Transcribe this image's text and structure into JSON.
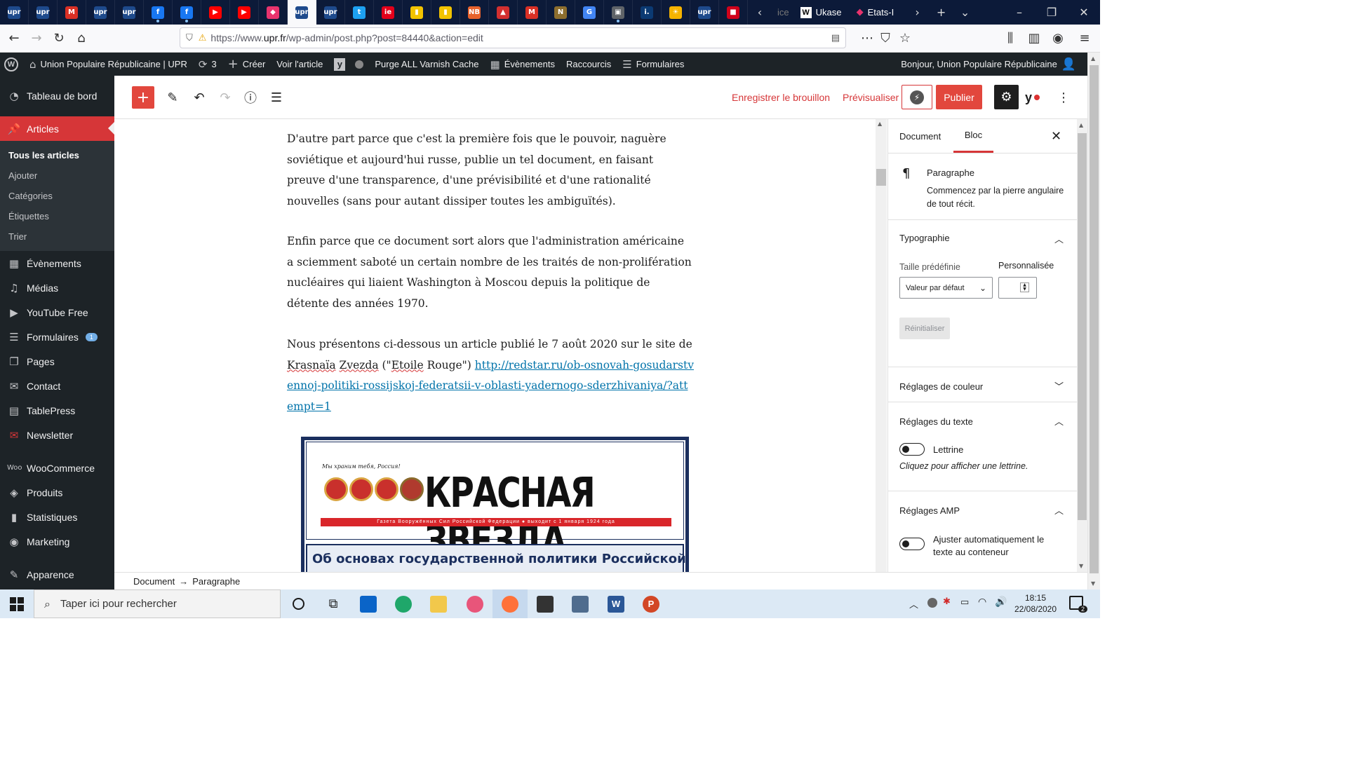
{
  "browser": {
    "tabs_favicons": [
      {
        "name": "upr-tab",
        "label": "upr",
        "color": "#1e4a8c"
      },
      {
        "name": "upr-tab",
        "label": "upr",
        "color": "#1e4a8c"
      },
      {
        "name": "gmail-tab",
        "label": "M",
        "color": "#d93025"
      },
      {
        "name": "upr-tab",
        "label": "upr",
        "color": "#1e4a8c"
      },
      {
        "name": "upr-tab",
        "label": "upr",
        "color": "#1e4a8c"
      },
      {
        "name": "facebook-tab",
        "label": "f",
        "color": "#1877f2"
      },
      {
        "name": "facebook-tab",
        "label": "f",
        "color": "#1877f2"
      },
      {
        "name": "youtube-tab",
        "label": "▶",
        "color": "#ff0000"
      },
      {
        "name": "youtube-tab",
        "label": "▶",
        "color": "#ff0000"
      },
      {
        "name": "app-tab",
        "label": "◆",
        "color": "#e8336d"
      },
      {
        "name": "upr-tab",
        "label": "upr",
        "color": "#1e4a8c"
      },
      {
        "name": "upr-tab",
        "label": "upr",
        "color": "#1e4a8c"
      },
      {
        "name": "twitter-tab",
        "label": "t",
        "color": "#1da1f2"
      },
      {
        "name": "app-tab",
        "label": "ie",
        "color": "#e2001a"
      },
      {
        "name": "app-tab",
        "label": "▮",
        "color": "#f2c300"
      },
      {
        "name": "app-tab",
        "label": "▮",
        "color": "#f2c300"
      },
      {
        "name": "app-tab",
        "label": "NB",
        "color": "#e8622c"
      },
      {
        "name": "app-tab",
        "label": "▲",
        "color": "#d32f2f"
      },
      {
        "name": "gmail-tab",
        "label": "M",
        "color": "#d93025"
      },
      {
        "name": "app-tab",
        "label": "N",
        "color": "#8d6e2e"
      },
      {
        "name": "translate-tab",
        "label": "G",
        "color": "#4285f4"
      },
      {
        "name": "app-tab",
        "label": "▣",
        "color": "#5f6368"
      },
      {
        "name": "app-tab",
        "label": "i.",
        "color": "#0b3a73"
      },
      {
        "name": "app-tab",
        "label": "☀",
        "color": "#f6b400"
      },
      {
        "name": "upr-tab",
        "label": "upr",
        "color": "#1e4a8c"
      },
      {
        "name": "app-tab",
        "label": "■",
        "color": "#d0021b"
      }
    ],
    "tab_partial_1": "ice",
    "tab_wiki": "Ukase",
    "tab_last": "Etats-I",
    "url_prefix": "https://www.",
    "url_domain": "upr.fr",
    "url_rest": "/wp-admin/post.php?post=84440&action=edit"
  },
  "adminbar": {
    "site": "Union Populaire Républicaine | UPR",
    "updates": "3",
    "create": "Créer",
    "view": "Voir l'article",
    "purge": "Purge ALL Varnish Cache",
    "events": "Évènements",
    "shortcuts": "Raccourcis",
    "forms": "Formulaires",
    "greeting": "Bonjour, Union Populaire Républicaine"
  },
  "sidebar": {
    "dashboard": "Tableau de bord",
    "articles": "Articles",
    "sub": [
      "Tous les articles",
      "Ajouter",
      "Catégories",
      "Étiquettes",
      "Trier"
    ],
    "events": "Évènements",
    "media": "Médias",
    "youtube": "YouTube Free",
    "forms": "Formulaires",
    "forms_badge": "1",
    "pages": "Pages",
    "contact": "Contact",
    "tablepress": "TablePress",
    "newsletter": "Newsletter",
    "woocommerce": "WooCommerce",
    "products": "Produits",
    "stats": "Statistiques",
    "marketing": "Marketing",
    "appearance": "Apparence"
  },
  "toolbar": {
    "save_draft": "Enregistrer le brouillon",
    "preview": "Prévisualiser",
    "publish": "Publier"
  },
  "content": {
    "p1": "D'autre part parce que c'est la première fois que le pouvoir, naguère soviétique et aujourd'hui russe, publie un tel document, en faisant preuve d'une transparence, d'une prévisibilité et d'une rationalité nouvelles (sans pour autant dissiper toutes les ambiguïtés).",
    "p2": "Enfin parce que ce document sort alors que l'administration américaine a sciemment saboté un certain nombre de les traités de non-prolifération nucléaires qui liaient Washington à Moscou depuis la politique de détente des années 1970.",
    "p3_start": "Nous présentons ci-dessous un article publié le 7 août 2020 sur le site de ",
    "p3_word1": "Krasnaïa",
    "p3_word2": "Zvezda",
    "p3_mid": " (\"",
    "p3_word3": "Etoile",
    "p3_end": " Rouge\")  ",
    "p3_link": "http://redstar.ru/ob-osnovah-gosudarstvennoj-politiki-rossijskoj-federatsii-v-oblasti-yadernogo-sderzhivaniya/?attempt=1",
    "img_motto": "Мы храним тебя, Россия!",
    "img_title": "КРАСНАЯ ЗВЕЗДА",
    "img_strip": "Газета Вооружённых Сил Российской Федерации  ●  выходит с 1 января 1924 года",
    "img_headline": "Об основах государственной политики Российской"
  },
  "panel": {
    "tab_document": "Document",
    "tab_block": "Bloc",
    "block_name": "Paragraphe",
    "block_desc": "Commencez par la pierre angulaire de tout récit.",
    "typography": "Typographie",
    "preset_size": "Taille prédéfinie",
    "custom": "Personnalisée",
    "default_value": "Valeur par défaut",
    "reset": "Réinitialiser",
    "color_settings": "Réglages de couleur",
    "text_settings": "Réglages du texte",
    "dropcap": "Lettrine",
    "dropcap_help": "Cliquez pour afficher une lettrine.",
    "amp_settings": "Réglages AMP",
    "amp_fit": "Ajuster automatiquement le texte au conteneur"
  },
  "breadcrumb": {
    "root": "Document",
    "arrow": "→",
    "current": "Paragraphe"
  },
  "taskbar": {
    "search_placeholder": "Taper ici pour rechercher",
    "time": "18:15",
    "date": "22/08/2020",
    "notif_count": "2"
  },
  "colors": {
    "wp_dark": "#1d2327",
    "wp_red": "#d63638",
    "link": "#0073aa"
  }
}
